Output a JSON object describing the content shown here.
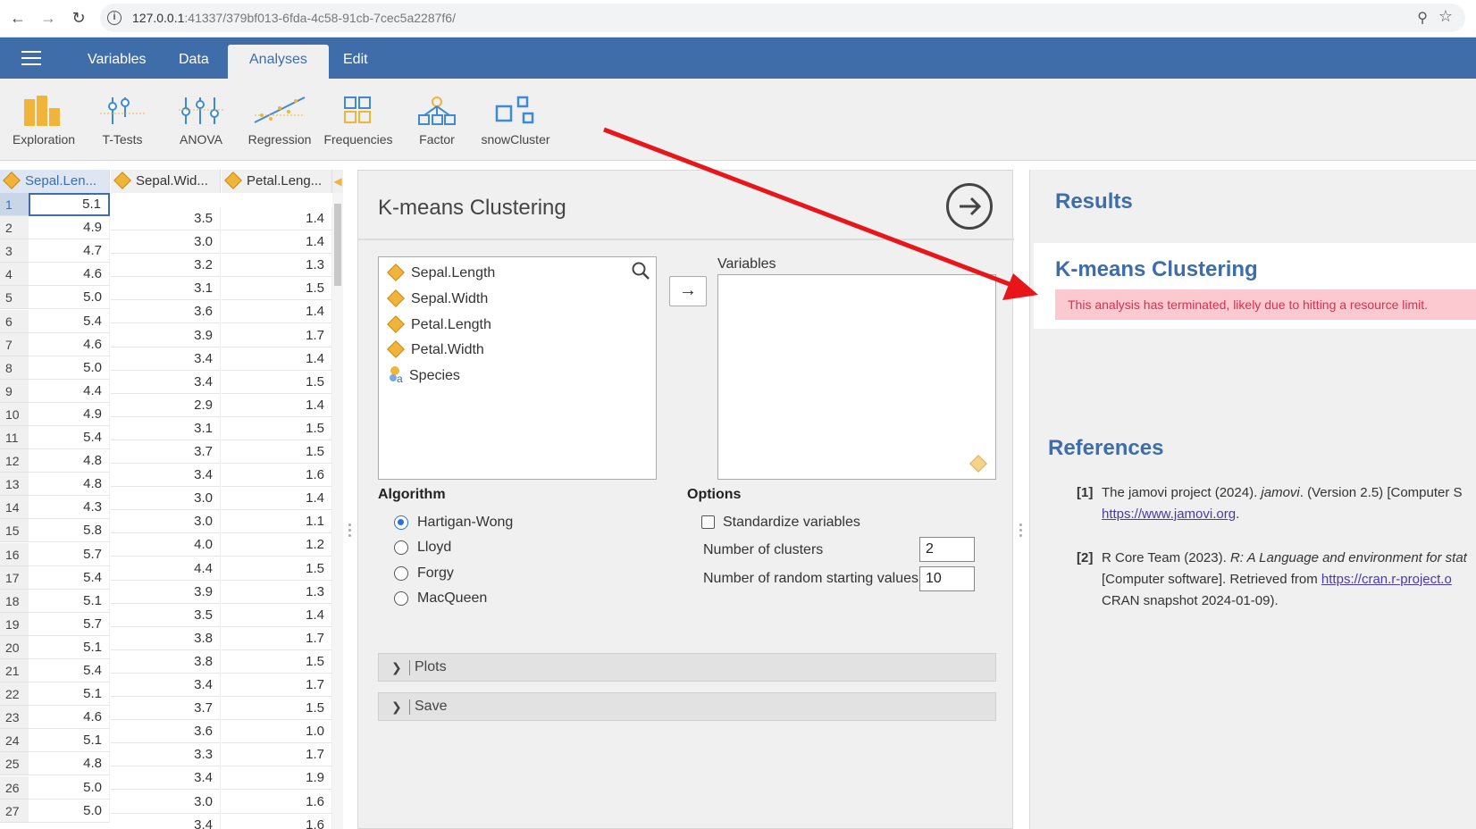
{
  "browser": {
    "url_host": "127.0.0.1",
    "url_rest": ":41337/379bf013-6fda-4c58-91cb-7cec5a2287f6/"
  },
  "ribbon": {
    "tabs": [
      "Variables",
      "Data",
      "Analyses",
      "Edit"
    ],
    "active_tab": "Analyses"
  },
  "toolbar": {
    "tools": [
      "Exploration",
      "T-Tests",
      "ANOVA",
      "Regression",
      "Frequencies",
      "Factor",
      "snowCluster"
    ]
  },
  "grid": {
    "columns": [
      "Sepal.Len...",
      "Sepal.Wid...",
      "Petal.Leng..."
    ],
    "rows": [
      [
        "1",
        "5.1",
        "3.5",
        "1.4"
      ],
      [
        "2",
        "4.9",
        "3.0",
        "1.4"
      ],
      [
        "3",
        "4.7",
        "3.2",
        "1.3"
      ],
      [
        "4",
        "4.6",
        "3.1",
        "1.5"
      ],
      [
        "5",
        "5.0",
        "3.6",
        "1.4"
      ],
      [
        "6",
        "5.4",
        "3.9",
        "1.7"
      ],
      [
        "7",
        "4.6",
        "3.4",
        "1.4"
      ],
      [
        "8",
        "5.0",
        "3.4",
        "1.5"
      ],
      [
        "9",
        "4.4",
        "2.9",
        "1.4"
      ],
      [
        "10",
        "4.9",
        "3.1",
        "1.5"
      ],
      [
        "11",
        "5.4",
        "3.7",
        "1.5"
      ],
      [
        "12",
        "4.8",
        "3.4",
        "1.6"
      ],
      [
        "13",
        "4.8",
        "3.0",
        "1.4"
      ],
      [
        "14",
        "4.3",
        "3.0",
        "1.1"
      ],
      [
        "15",
        "5.8",
        "4.0",
        "1.2"
      ],
      [
        "16",
        "5.7",
        "4.4",
        "1.5"
      ],
      [
        "17",
        "5.4",
        "3.9",
        "1.3"
      ],
      [
        "18",
        "5.1",
        "3.5",
        "1.4"
      ],
      [
        "19",
        "5.7",
        "3.8",
        "1.7"
      ],
      [
        "20",
        "5.1",
        "3.8",
        "1.5"
      ],
      [
        "21",
        "5.4",
        "3.4",
        "1.7"
      ],
      [
        "22",
        "5.1",
        "3.7",
        "1.5"
      ],
      [
        "23",
        "4.6",
        "3.6",
        "1.0"
      ],
      [
        "24",
        "5.1",
        "3.3",
        "1.7"
      ],
      [
        "25",
        "4.8",
        "3.4",
        "1.9"
      ],
      [
        "26",
        "5.0",
        "3.0",
        "1.6"
      ],
      [
        "27",
        "5.0",
        "3.4",
        "1.6"
      ]
    ]
  },
  "options": {
    "title": "K-means Clustering",
    "variables": [
      "Sepal.Length",
      "Sepal.Width",
      "Petal.Length",
      "Petal.Width",
      "Species"
    ],
    "target_label": "Variables",
    "algorithm_title": "Algorithm",
    "algorithms": [
      "Hartigan-Wong",
      "Lloyd",
      "Forgy",
      "MacQueen"
    ],
    "selected_algorithm": "Hartigan-Wong",
    "options_title": "Options",
    "standardize_label": "Standardize variables",
    "clusters_label": "Number of clusters",
    "clusters_value": "2",
    "starts_label": "Number of random starting values",
    "starts_value": "10",
    "plots_label": "Plots",
    "save_label": "Save"
  },
  "results": {
    "title": "Results",
    "analysis_title": "K-means Clustering",
    "error": "This analysis has terminated, likely due to hitting a resource limit.",
    "references_title": "References",
    "ref1_num": "[1]",
    "ref1_a": "The jamovi project (2024). ",
    "ref1_b": "jamovi",
    "ref1_c": ". (Version 2.5) [Computer S",
    "ref1_link": "https://www.jamovi.org",
    "ref1_end": ".",
    "ref2_num": "[2]",
    "ref2_a": "R Core Team (2023). ",
    "ref2_b": "R: A Language and environment for stat",
    "ref2_c": "[Computer software]. Retrieved from ",
    "ref2_link": "https://cran.r-project.o",
    "ref2_d": "CRAN snapshot 2024-01-09)."
  }
}
